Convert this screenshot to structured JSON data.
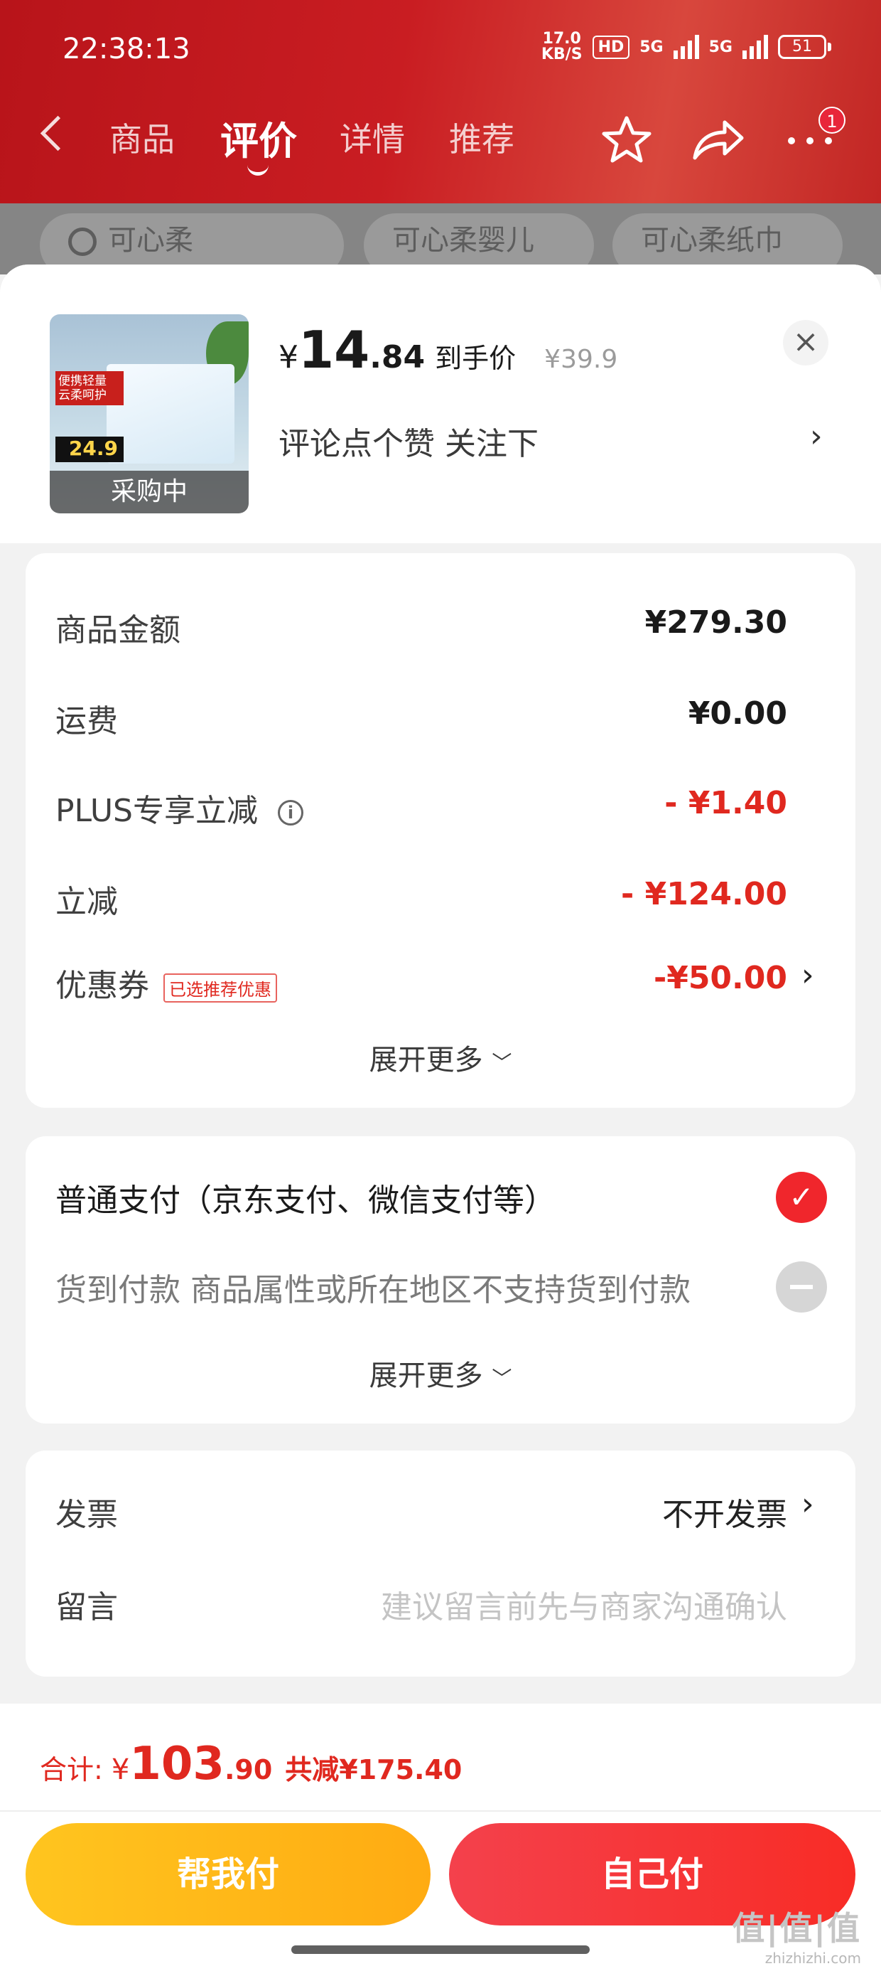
{
  "status_bar": {
    "time": "22:38:13",
    "net_speed_value": "17.0",
    "net_speed_unit": "KB/S",
    "hd_label": "HD",
    "sim1_label": "5G",
    "sim2_label": "5G",
    "battery": "51"
  },
  "nav": {
    "tabs": [
      "商品",
      "评价",
      "详情",
      "推荐"
    ],
    "active_tab": "评价",
    "badge_count": "1"
  },
  "search_chips": [
    "可心柔",
    "可心柔婴儿",
    "可心柔纸巾"
  ],
  "product": {
    "thumbnail_promo": "便携轻量 云柔呵护",
    "thumbnail_price": "24.9",
    "thumbnail_status": "采购中",
    "currency": "¥",
    "price_int": "14",
    "price_dec": ".84",
    "price_tag": "到手价",
    "original_price": "¥39.9",
    "promo_text": "评论点个赞  关注下"
  },
  "order_summary": {
    "rows": [
      {
        "label": "商品金额",
        "value": "¥279.30",
        "highlight": false
      },
      {
        "label": "运费",
        "value": "¥0.00",
        "highlight": false
      },
      {
        "label": "PLUS专享立减",
        "value": "- ¥1.40",
        "highlight": true
      },
      {
        "label": "立减",
        "value": "- ¥124.00",
        "highlight": true
      },
      {
        "label": "优惠券",
        "value": "-¥50.00",
        "highlight": true
      }
    ],
    "coupon_tag": "已选推荐优惠",
    "expand_label": "展开更多"
  },
  "payment": {
    "options": [
      {
        "label": "普通支付（京东支付、微信支付等）",
        "selected": true,
        "enabled": true
      },
      {
        "label": "货到付款 商品属性或所在地区不支持货到付款",
        "selected": false,
        "enabled": false
      }
    ],
    "expand_label": "展开更多"
  },
  "extras": {
    "invoice_label": "发票",
    "invoice_value": "不开发票",
    "message_label": "留言",
    "message_placeholder": "建议留言前先与商家沟通确认"
  },
  "footer": {
    "total_label": "合计: ",
    "currency": "¥",
    "total_int": "103",
    "total_dec": ".90",
    "saved_label": "共减¥175.40",
    "help_pay_label": "帮我付",
    "self_pay_label": "自己付"
  },
  "watermark": {
    "text": "值|值|值",
    "url": "zhizhizhi.com"
  },
  "colors": {
    "header_red": "#c91d22",
    "accent_red": "#e0281f",
    "help_button": "#ffb816",
    "self_button": "#f4414c"
  }
}
